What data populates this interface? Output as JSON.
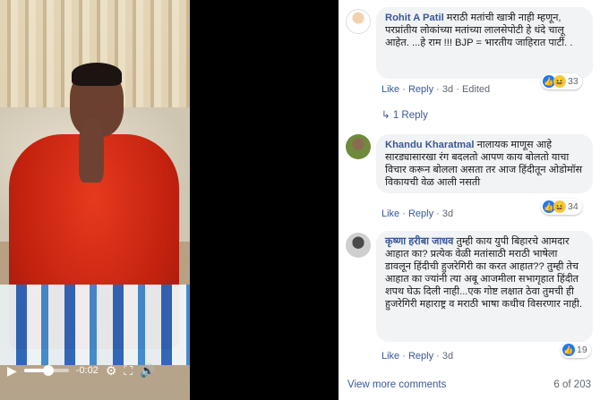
{
  "video": {
    "time_label": "-0:02",
    "progress": 0.55,
    "play_icon": "play-icon",
    "settings_icon": "gear-icon",
    "fullscreen_icon": "fullscreen-icon",
    "volume_icon": "volume-icon"
  },
  "comments": [
    {
      "author": "Rohit A Patil",
      "text": " मराठी मतांची खात्री नाही म्हणून, परप्रांतीय लोकांच्या मतांच्या लालसेपोटी हे धंदे चालू आहेत. ...हे राम !!! BJP = भारतीय जाहिरात पार्टी. .",
      "like": "Like",
      "reply": "Reply",
      "time": "3d",
      "edited": "Edited",
      "reaction_count": "33"
    },
    {
      "author": "Khandu Kharatmal",
      "text": " नालायक माणूस आहे सारड्यासारखा रंग बदलतो आपण काय बोलतो याचा विचार करून बोलला असता तर आज हिंदीतून ओडोमॉस विकायची वेळ आली नसती",
      "like": "Like",
      "reply": "Reply",
      "time": "3d",
      "reaction_count": "34"
    },
    {
      "author": "कृष्णा हरीबा जाधव",
      "text": " तुम्ही काय युपी बिहारचे आमदार आहात का? प्रत्येक वेळी मतांसाठी मराठी भाषेला डावलून हिंदीची हुजरेगिरी का करत आहात?? तुम्ही तेच आहात का ज्यांनी त्या अबू आजमीला सभागृहात हिंदीत शपथ घेऊ दिली नाही...एक गोष्ट लक्षात ठेवा तुमची ही हुजरेगिरी महाराष्ट्र व मराठी भाषा कधीच विसरणार नाही.",
      "like": "Like",
      "reply": "Reply",
      "time": "3d",
      "reaction_count": "19"
    }
  ],
  "reply_link": "1 Reply",
  "sep": "·",
  "footer": {
    "view_more": "View more comments",
    "count": "6 of 203"
  }
}
